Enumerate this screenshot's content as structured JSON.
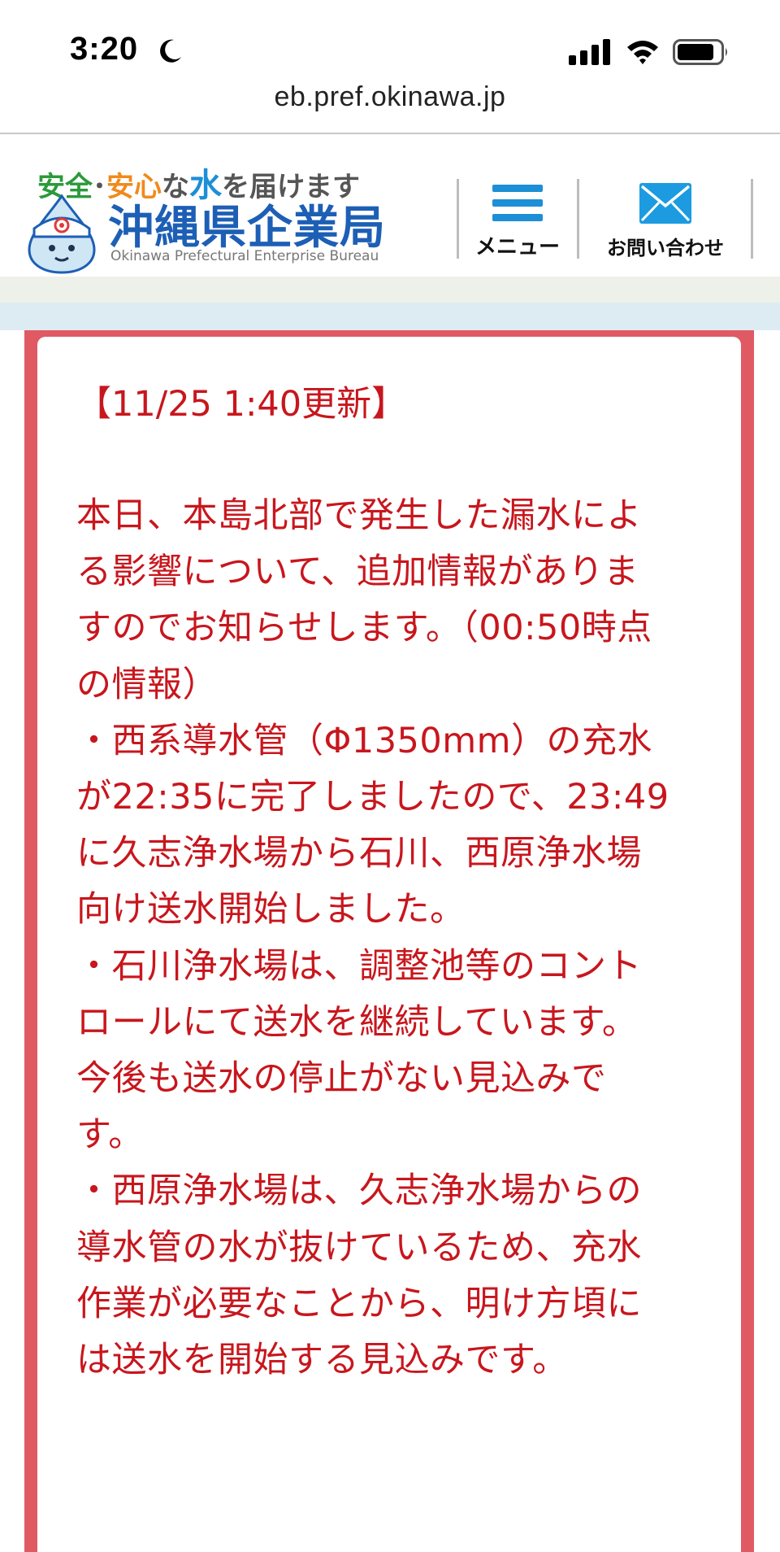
{
  "status_bar": {
    "time": "3:20",
    "moon_icon": "moon-icon",
    "signal_icon": "cellular-signal-icon",
    "wifi_icon": "wifi-icon",
    "battery_icon": "battery-icon"
  },
  "browser": {
    "url": "eb.pref.okinawa.jp"
  },
  "header": {
    "tagline_part1": "安全",
    "tagline_dot": "･",
    "tagline_part2": "安心",
    "tagline_part3": "な",
    "tagline_part4": "水",
    "tagline_part5": "を届けます",
    "org_name": "沖縄県企業局",
    "org_name_en": "Okinawa Prefectural Enterprise Bureau",
    "menu_label": "メニュー",
    "contact_label": "お問い合わせ",
    "colors": {
      "brand_blue": "#1d5fb5",
      "green": "#2a9a3a",
      "orange": "#f08a1c",
      "water_blue": "#1c8fd6"
    }
  },
  "notice": {
    "update_label": "【11/25 1:40更新】",
    "lines": [
      "本日、本島北部で発生した漏水によ",
      "る影響について、追加情報がありま",
      "すのでお知らせします。（00:50時点",
      "の情報）",
      "・西系導水管（Φ1350mm）の充水",
      "が22:35に完了しましたので、23:49",
      "に久志浄水場から石川、西原浄水場",
      "向け送水開始しました。",
      "・石川浄水場は、調整池等のコント",
      "ロールにて送水を継続しています。",
      "今後も送水の停止がない見込みで",
      "す。",
      "・西原浄水場は、久志浄水場からの",
      "導水管の水が抜けているため、充水",
      "作業が必要なことから、明け方頃に",
      "は送水を開始する見込みです。"
    ],
    "colors": {
      "text": "#c8161d",
      "frame": "#e05a64"
    }
  }
}
